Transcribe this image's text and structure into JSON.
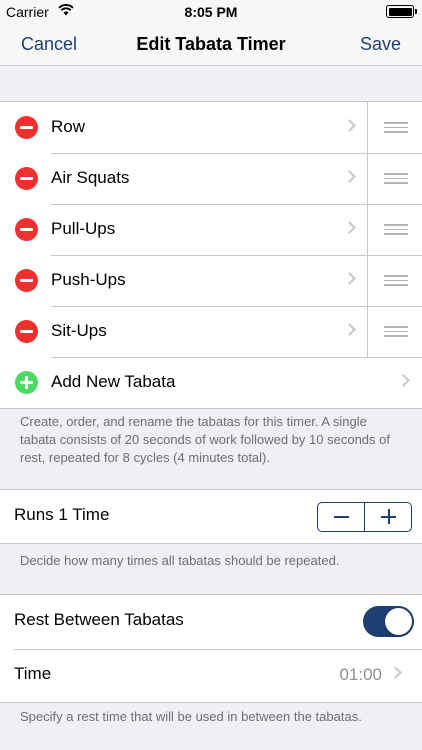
{
  "status_bar": {
    "carrier": "Carrier",
    "time": "8:05 PM",
    "battery_level": 1.0
  },
  "nav": {
    "cancel_label": "Cancel",
    "title": "Edit Tabata Timer",
    "save_label": "Save"
  },
  "tabatas": [
    {
      "label": "Row"
    },
    {
      "label": "Air Squats"
    },
    {
      "label": "Pull-Ups"
    },
    {
      "label": "Push-Ups"
    },
    {
      "label": "Sit-Ups"
    }
  ],
  "add_new_label": "Add New Tabata",
  "tabatas_footer": "Create, order, and rename the tabatas for this timer.  A single tabata consists of 20 seconds of work followed by 10 seconds of rest, repeated for 8 cycles (4 minutes total).",
  "runs": {
    "label": "Runs 1 Time",
    "footer": "Decide how many times all tabatas should be repeated."
  },
  "rest": {
    "toggle_label": "Rest Between Tabatas",
    "toggle_on": true,
    "time_label": "Time",
    "time_value": "01:00",
    "footer": "Specify a rest time that will be used in between the tabatas."
  },
  "colors": {
    "accent": "#1f3f73",
    "delete": "#f0302e",
    "add": "#4cd964",
    "background": "#efeff4"
  },
  "icons": {
    "delete": "minus-circle-icon",
    "add": "plus-circle-icon",
    "chevron": "chevron-right-icon",
    "reorder": "reorder-grip-icon"
  }
}
